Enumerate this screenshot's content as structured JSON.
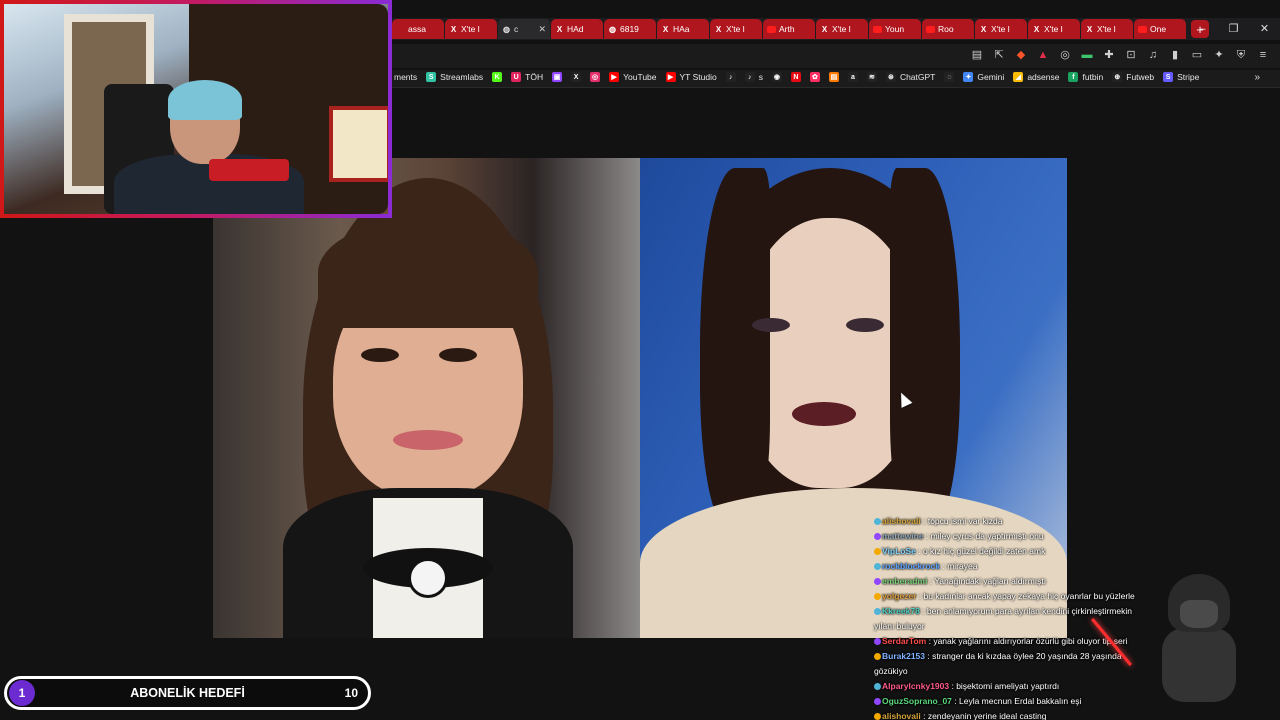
{
  "browser": {
    "tabs": [
      {
        "label": "assa",
        "icon": "tab-icon",
        "active": false
      },
      {
        "label": "X'te l",
        "icon": "x-icon",
        "active": false
      },
      {
        "label": "c",
        "icon": "globe-icon",
        "active": true
      },
      {
        "label": "HAd",
        "icon": "x-icon",
        "active": false
      },
      {
        "label": "6819",
        "icon": "globe-icon",
        "active": false
      },
      {
        "label": "HAa",
        "icon": "x-icon",
        "active": false
      },
      {
        "label": "X'te l",
        "icon": "x-icon",
        "active": false
      },
      {
        "label": "Arth",
        "icon": "youtube-icon",
        "active": false
      },
      {
        "label": "X'te l",
        "icon": "x-icon",
        "active": false
      },
      {
        "label": "Youn",
        "icon": "youtube-icon",
        "active": false
      },
      {
        "label": "Roo",
        "icon": "youtube-icon",
        "active": false
      },
      {
        "label": "X'te l",
        "icon": "x-icon",
        "active": false
      },
      {
        "label": "X'te l",
        "icon": "x-icon",
        "active": false
      },
      {
        "label": "X'te l",
        "icon": "x-icon",
        "active": false
      },
      {
        "label": "One",
        "icon": "youtube-icon",
        "active": false
      }
    ],
    "new_tab_label": "+",
    "window_controls": {
      "minimize": "–",
      "maximize": "❐",
      "close": "✕"
    },
    "bookmarks": [
      {
        "label": "ments",
        "icon": "",
        "color": ""
      },
      {
        "label": "Streamlabs",
        "icon": "S",
        "color": "#31c3a2"
      },
      {
        "label": "",
        "icon": "K",
        "color": "#53fc18"
      },
      {
        "label": "TÖH",
        "icon": "U",
        "color": "#e0245e"
      },
      {
        "label": "",
        "icon": "▣",
        "color": "#9146ff"
      },
      {
        "label": "",
        "icon": "X",
        "color": "#222222"
      },
      {
        "label": "",
        "icon": "◎",
        "color": "#e1306c"
      },
      {
        "label": "YouTube",
        "icon": "▶",
        "color": "#ff0000"
      },
      {
        "label": "YT Studio",
        "icon": "▶",
        "color": "#ff0000"
      },
      {
        "label": "",
        "icon": "♪",
        "color": "#222222"
      },
      {
        "label": "s",
        "icon": "♪",
        "color": "#222222"
      },
      {
        "label": "",
        "icon": "◉",
        "color": "#222222"
      },
      {
        "label": "",
        "icon": "N",
        "color": "#e50914"
      },
      {
        "label": "",
        "icon": "✿",
        "color": "#ff2e63"
      },
      {
        "label": "",
        "icon": "▤",
        "color": "#ff7a00"
      },
      {
        "label": "",
        "icon": "a",
        "color": "#222222"
      },
      {
        "label": "",
        "icon": "≋",
        "color": "#222222"
      },
      {
        "label": "ChatGPT",
        "icon": "⊛",
        "color": "#222222"
      },
      {
        "label": "",
        "icon": "◌",
        "color": "#222222"
      },
      {
        "label": "Gemini",
        "icon": "✦",
        "color": "#4285f4"
      },
      {
        "label": "adsense",
        "icon": "◢",
        "color": "#fbbc04"
      },
      {
        "label": "futbin",
        "icon": "f",
        "color": "#1aa260"
      },
      {
        "label": "Futweb",
        "icon": "⊕",
        "color": "#222222"
      },
      {
        "label": "Stripe",
        "icon": "S",
        "color": "#635bff"
      }
    ],
    "bookmarks_more": "»"
  },
  "stream": {
    "goal": {
      "current": "1",
      "title": "ABONELİK HEDEFİ",
      "target": "10"
    },
    "chat": [
      {
        "user": "alishovali",
        "user_color": "#d6a53a",
        "text": ": topcu ismi var kizda"
      },
      {
        "user": "mattewine",
        "user_color": "#8fa6b8",
        "text": ": miley cyrus da yaptırmıştı onu"
      },
      {
        "user": "VipLoSe",
        "user_color": "#7fd4ff",
        "text": ": o kız hiç güzel değildi zaten amk"
      },
      {
        "user": "rockblockrock",
        "user_color": "#5aa0ff",
        "text": ": mirayea"
      },
      {
        "user": "emberadmi",
        "user_color": "#7ad17a",
        "text": ": Yanağındaki yağları aldırmıştı"
      },
      {
        "user": "yolgezer",
        "user_color": "#e0a040",
        "text": ": bu kadınlar ancak yapay zekaya hiç oyanrlar bu yüzlerle"
      },
      {
        "user": "Kkreek78",
        "user_color": "#4fd0c2",
        "text": ": ben anlamıyorum para ayrılan kendini çirkinleştirmekin yılanı buluyor"
      },
      {
        "user": "SerdarTom",
        "user_color": "#ff4d4d",
        "text": ": yanak yağlarını aldırıyorlar özürlü gibi oluyor tip seri"
      },
      {
        "user": "Burak2153",
        "user_color": "#7fb2ff",
        "text": ": stranger da ki kızdaa öylee 20 yaşında 28 yaşında gözükiyo"
      },
      {
        "user": "Alparylcnky1903",
        "user_color": "#ff5a8a",
        "text": ": bişektomi ameliyatı yaptırdı"
      },
      {
        "user": "OguzSoprano_07",
        "user_color": "#5ad67a",
        "text": ": Leyla mecnun Erdal bakkalın eşi"
      },
      {
        "user": "alishovali",
        "user_color": "#d6a53a",
        "text": ": zendeyanin yerine ideal casting"
      }
    ]
  }
}
